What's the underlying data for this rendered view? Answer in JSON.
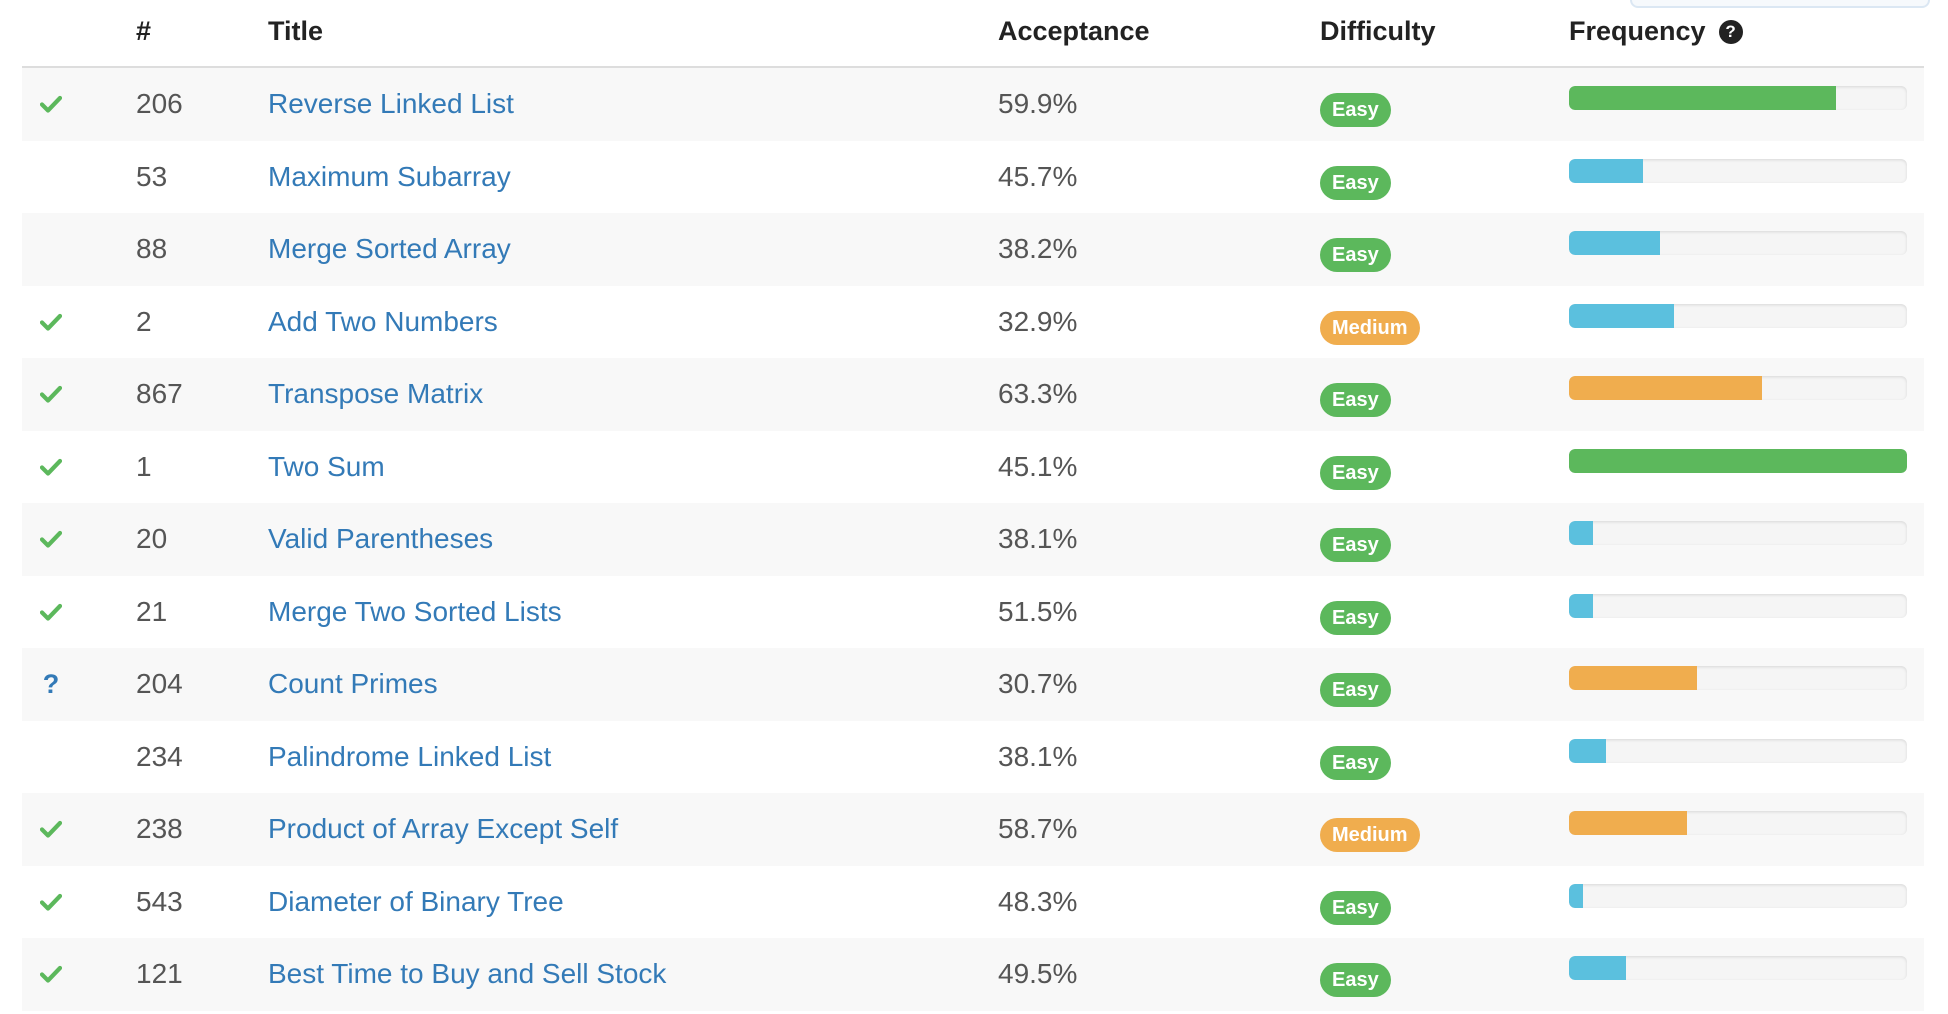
{
  "table": {
    "headers": {
      "num": "#",
      "title": "Title",
      "acceptance": "Acceptance",
      "difficulty": "Difficulty",
      "frequency": "Frequency",
      "frequency_help": "?"
    },
    "colors": {
      "easy": "#5cb85c",
      "medium": "#f0ad4e",
      "bar_green": "#5cb85c",
      "bar_blue": "#5bc0de",
      "bar_orange": "#f0ad4e",
      "link": "#337ab7"
    },
    "rows": [
      {
        "status": "solved",
        "num": "206",
        "title": "Reverse Linked List",
        "acceptance": "59.9%",
        "difficulty": "Easy",
        "frequency": 0.79,
        "freq_color": "green"
      },
      {
        "status": "none",
        "num": "53",
        "title": "Maximum Subarray",
        "acceptance": "45.7%",
        "difficulty": "Easy",
        "frequency": 0.22,
        "freq_color": "blue"
      },
      {
        "status": "none",
        "num": "88",
        "title": "Merge Sorted Array",
        "acceptance": "38.2%",
        "difficulty": "Easy",
        "frequency": 0.27,
        "freq_color": "blue"
      },
      {
        "status": "solved",
        "num": "2",
        "title": "Add Two Numbers",
        "acceptance": "32.9%",
        "difficulty": "Medium",
        "frequency": 0.31,
        "freq_color": "blue"
      },
      {
        "status": "solved",
        "num": "867",
        "title": "Transpose Matrix",
        "acceptance": "63.3%",
        "difficulty": "Easy",
        "frequency": 0.57,
        "freq_color": "orange"
      },
      {
        "status": "solved",
        "num": "1",
        "title": "Two Sum",
        "acceptance": "45.1%",
        "difficulty": "Easy",
        "frequency": 1.0,
        "freq_color": "green"
      },
      {
        "status": "solved",
        "num": "20",
        "title": "Valid Parentheses",
        "acceptance": "38.1%",
        "difficulty": "Easy",
        "frequency": 0.07,
        "freq_color": "blue"
      },
      {
        "status": "solved",
        "num": "21",
        "title": "Merge Two Sorted Lists",
        "acceptance": "51.5%",
        "difficulty": "Easy",
        "frequency": 0.07,
        "freq_color": "blue"
      },
      {
        "status": "attempted",
        "num": "204",
        "title": "Count Primes",
        "acceptance": "30.7%",
        "difficulty": "Easy",
        "frequency": 0.38,
        "freq_color": "orange"
      },
      {
        "status": "none",
        "num": "234",
        "title": "Palindrome Linked List",
        "acceptance": "38.1%",
        "difficulty": "Easy",
        "frequency": 0.11,
        "freq_color": "blue"
      },
      {
        "status": "solved",
        "num": "238",
        "title": "Product of Array Except Self",
        "acceptance": "58.7%",
        "difficulty": "Medium",
        "frequency": 0.35,
        "freq_color": "orange"
      },
      {
        "status": "solved",
        "num": "543",
        "title": "Diameter of Binary Tree",
        "acceptance": "48.3%",
        "difficulty": "Easy",
        "frequency": 0.04,
        "freq_color": "blue"
      },
      {
        "status": "solved",
        "num": "121",
        "title": "Best Time to Buy and Sell Stock",
        "acceptance": "49.5%",
        "difficulty": "Easy",
        "frequency": 0.17,
        "freq_color": "blue"
      }
    ]
  }
}
